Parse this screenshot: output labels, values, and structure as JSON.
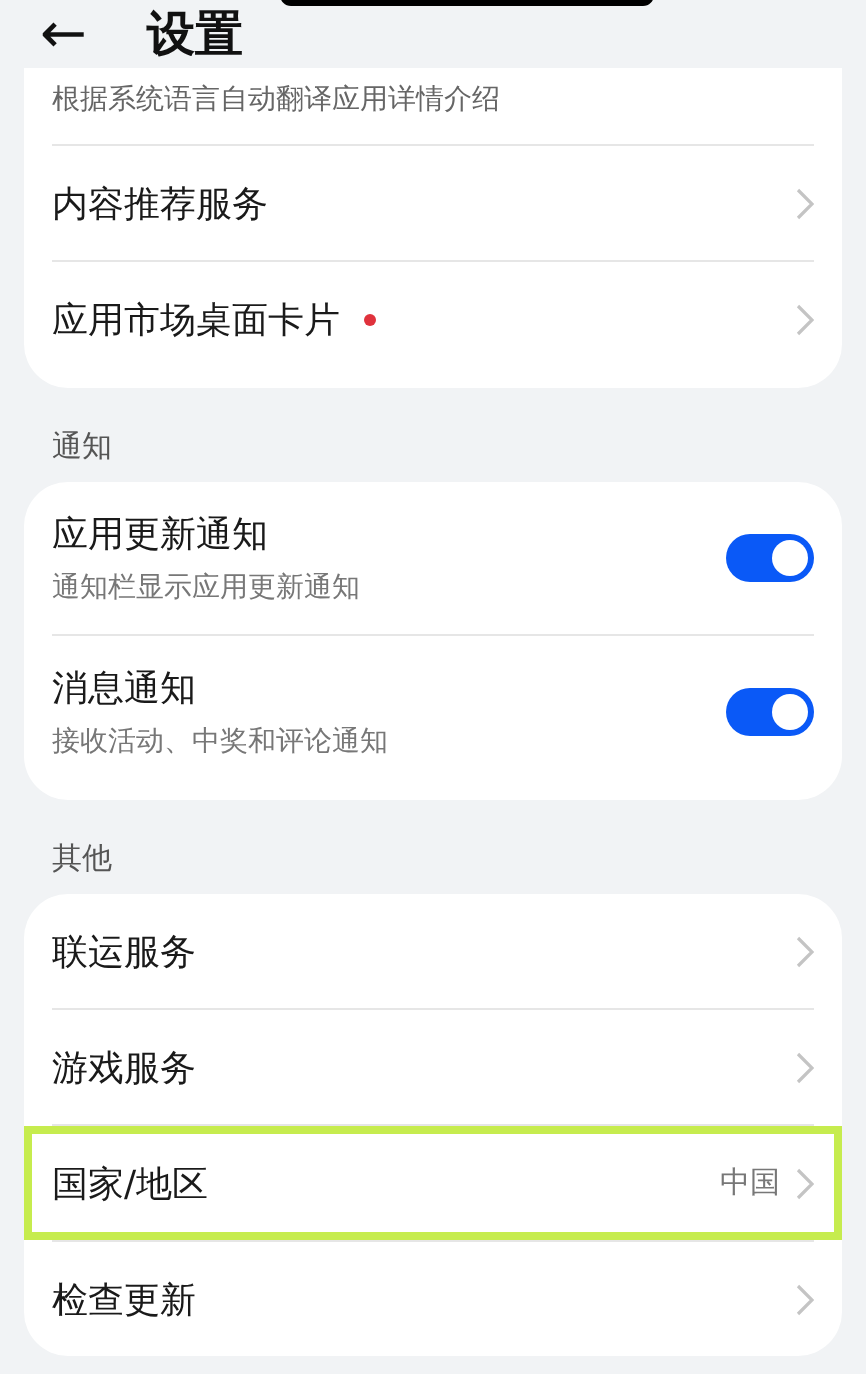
{
  "header": {
    "back_icon": "←",
    "title": "设置"
  },
  "top_card": {
    "description": "根据系统语言自动翻译应用详情介绍",
    "items": [
      {
        "label": "内容推荐服务",
        "badge": false
      },
      {
        "label": "应用市场桌面卡片",
        "badge": true
      }
    ]
  },
  "notifications": {
    "heading": "通知",
    "items": [
      {
        "title": "应用更新通知",
        "subtitle": "通知栏显示应用更新通知",
        "on": true
      },
      {
        "title": "消息通知",
        "subtitle": "接收活动、中奖和评论通知",
        "on": true
      }
    ]
  },
  "other": {
    "heading": "其他",
    "items": [
      {
        "label": "联运服务",
        "selected": false
      },
      {
        "label": "游戏服务",
        "selected": false
      },
      {
        "label": "国家/地区",
        "value": "中国",
        "selected": true
      },
      {
        "label": "检查更新",
        "selected": false
      }
    ]
  }
}
